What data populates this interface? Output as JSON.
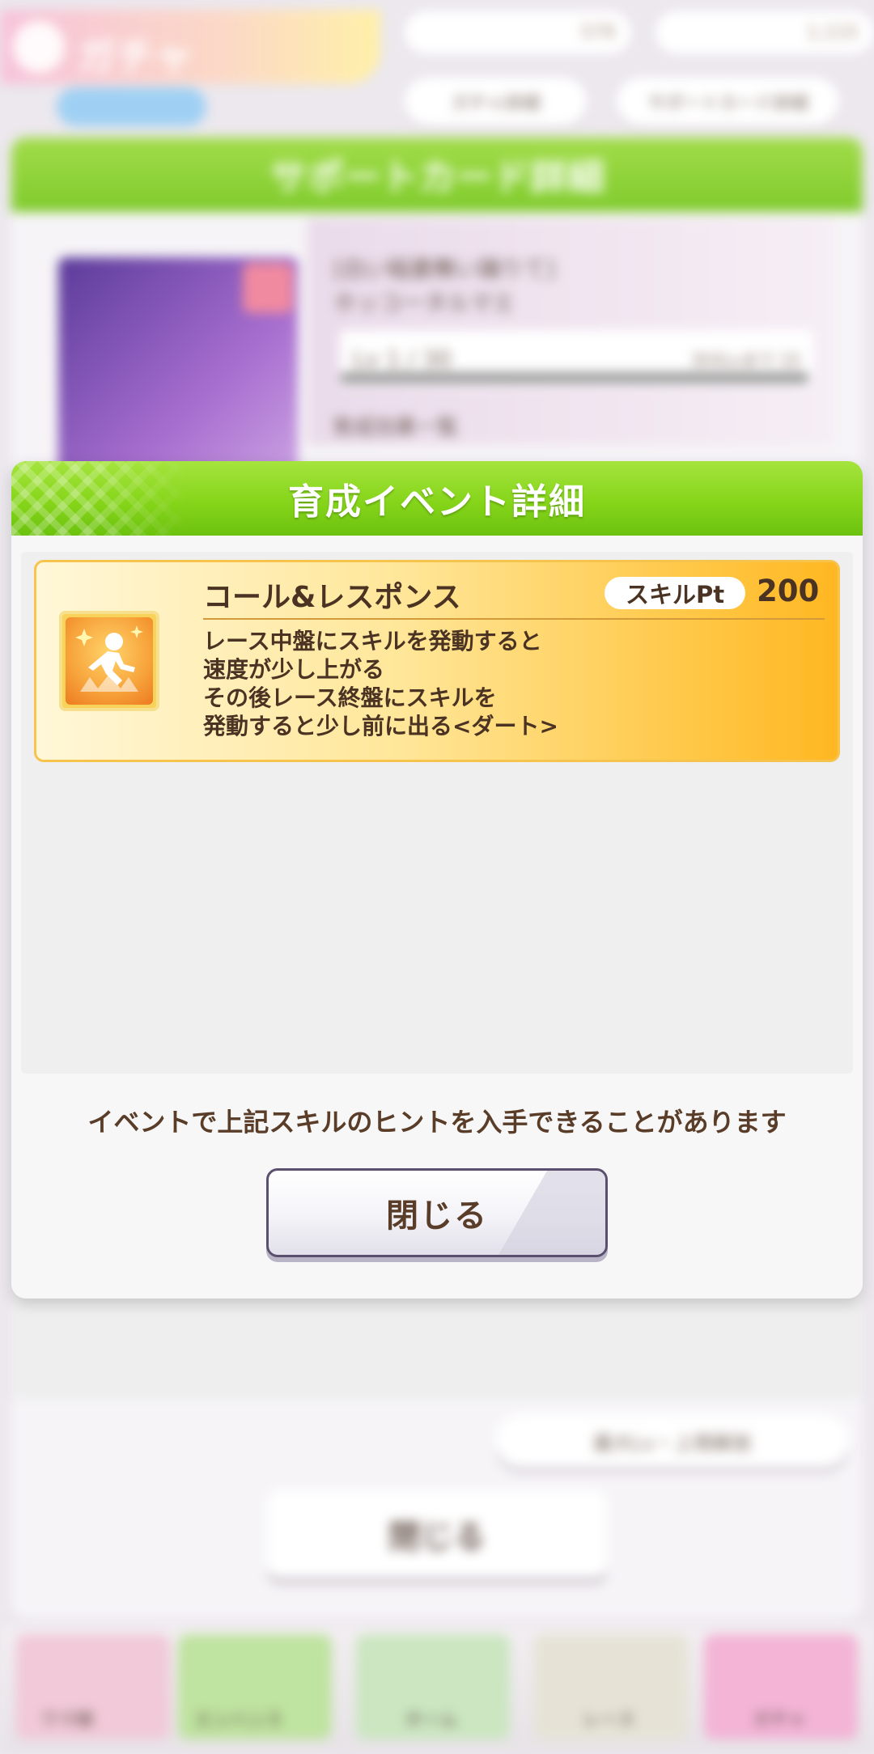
{
  "background": {
    "header_title": "ガチャ",
    "currency_1": "579",
    "currency_2": "1,115",
    "pill_gacha_detail": "ガチャ詳細",
    "pill_card_detail": "サポートカード詳細",
    "card_panel_title": "サポートカード詳細",
    "card_name_line1": "[白い稲妻舞い踊りて]",
    "card_name_line2": "ホッコータルマエ",
    "level_text": "Lv 1 / 30",
    "level_max_text": "次のLvまで 15",
    "effects_label": "育成効果一覧",
    "limit_break_button": "最大Lv・上限解放",
    "close_button": "閉じる",
    "nav_items": [
      "ウマ娘",
      "エンハンス",
      "ホーム",
      "レース",
      "ガチャ"
    ]
  },
  "modal": {
    "title": "育成イベント詳細",
    "skill": {
      "name": "コール&レスポンス",
      "pt_label": "スキルPt",
      "pt_value": "200",
      "description": [
        "レース中盤にスキルを発動すると",
        "速度が少し上がる",
        "その後レース終盤にスキルを",
        "発動すると少し前に出る<ダート>"
      ],
      "icon": "speed-up-runner-icon"
    },
    "hint": "イベントで上記スキルのヒントを入手できることがあります",
    "close_label": "閉じる"
  },
  "colors": {
    "header_green": "#86d51a",
    "skill_gold": "#ffc94a",
    "text_brown": "#4b3324"
  }
}
